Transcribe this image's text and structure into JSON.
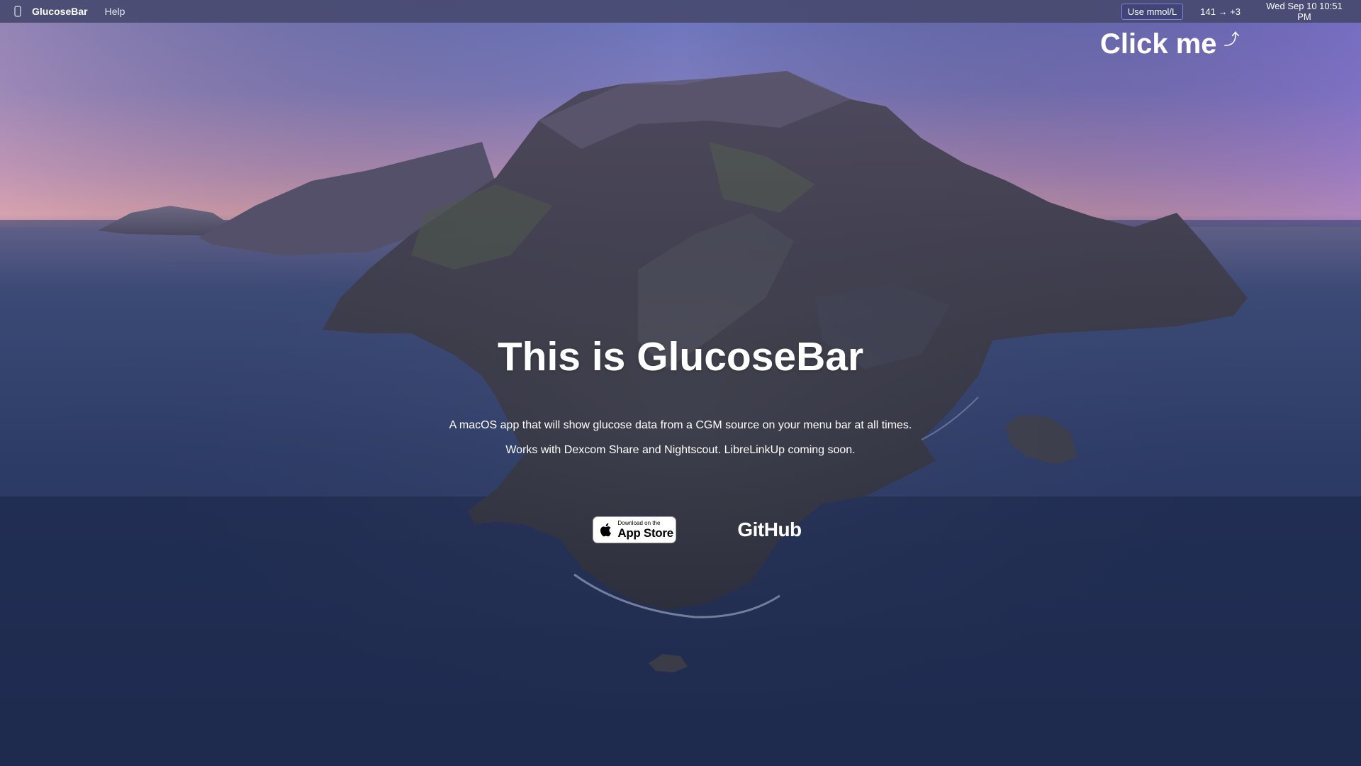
{
  "menubar": {
    "app_name": "GlucoseBar",
    "help_label": "Help",
    "units_button_label": "Use mmol/L",
    "glucose_reading": "141 → +3",
    "clock": "Wed Sep 10  10:51 PM"
  },
  "callout": {
    "text": "Click me",
    "arrow": "⤴"
  },
  "hero": {
    "title": "This is GlucoseBar",
    "description": "A macOS app that will show glucose data from a CGM source on your menu bar at all times.",
    "compatibility": "Works with Dexcom Share and Nightscout. LibreLinkUp coming soon."
  },
  "links": {
    "appstore_small": "Download on the",
    "appstore_large": "App Store",
    "github_label": "GitHub"
  },
  "colors": {
    "menubar_bg": "#484a70",
    "units_border": "#7c83d8",
    "sky_top": "#6a74b8",
    "sky_horizon": "#c99ab8",
    "sea": "#2a3760"
  },
  "icons": {
    "apple": "apple-icon",
    "arrow": "arrow-up-right-icon"
  }
}
